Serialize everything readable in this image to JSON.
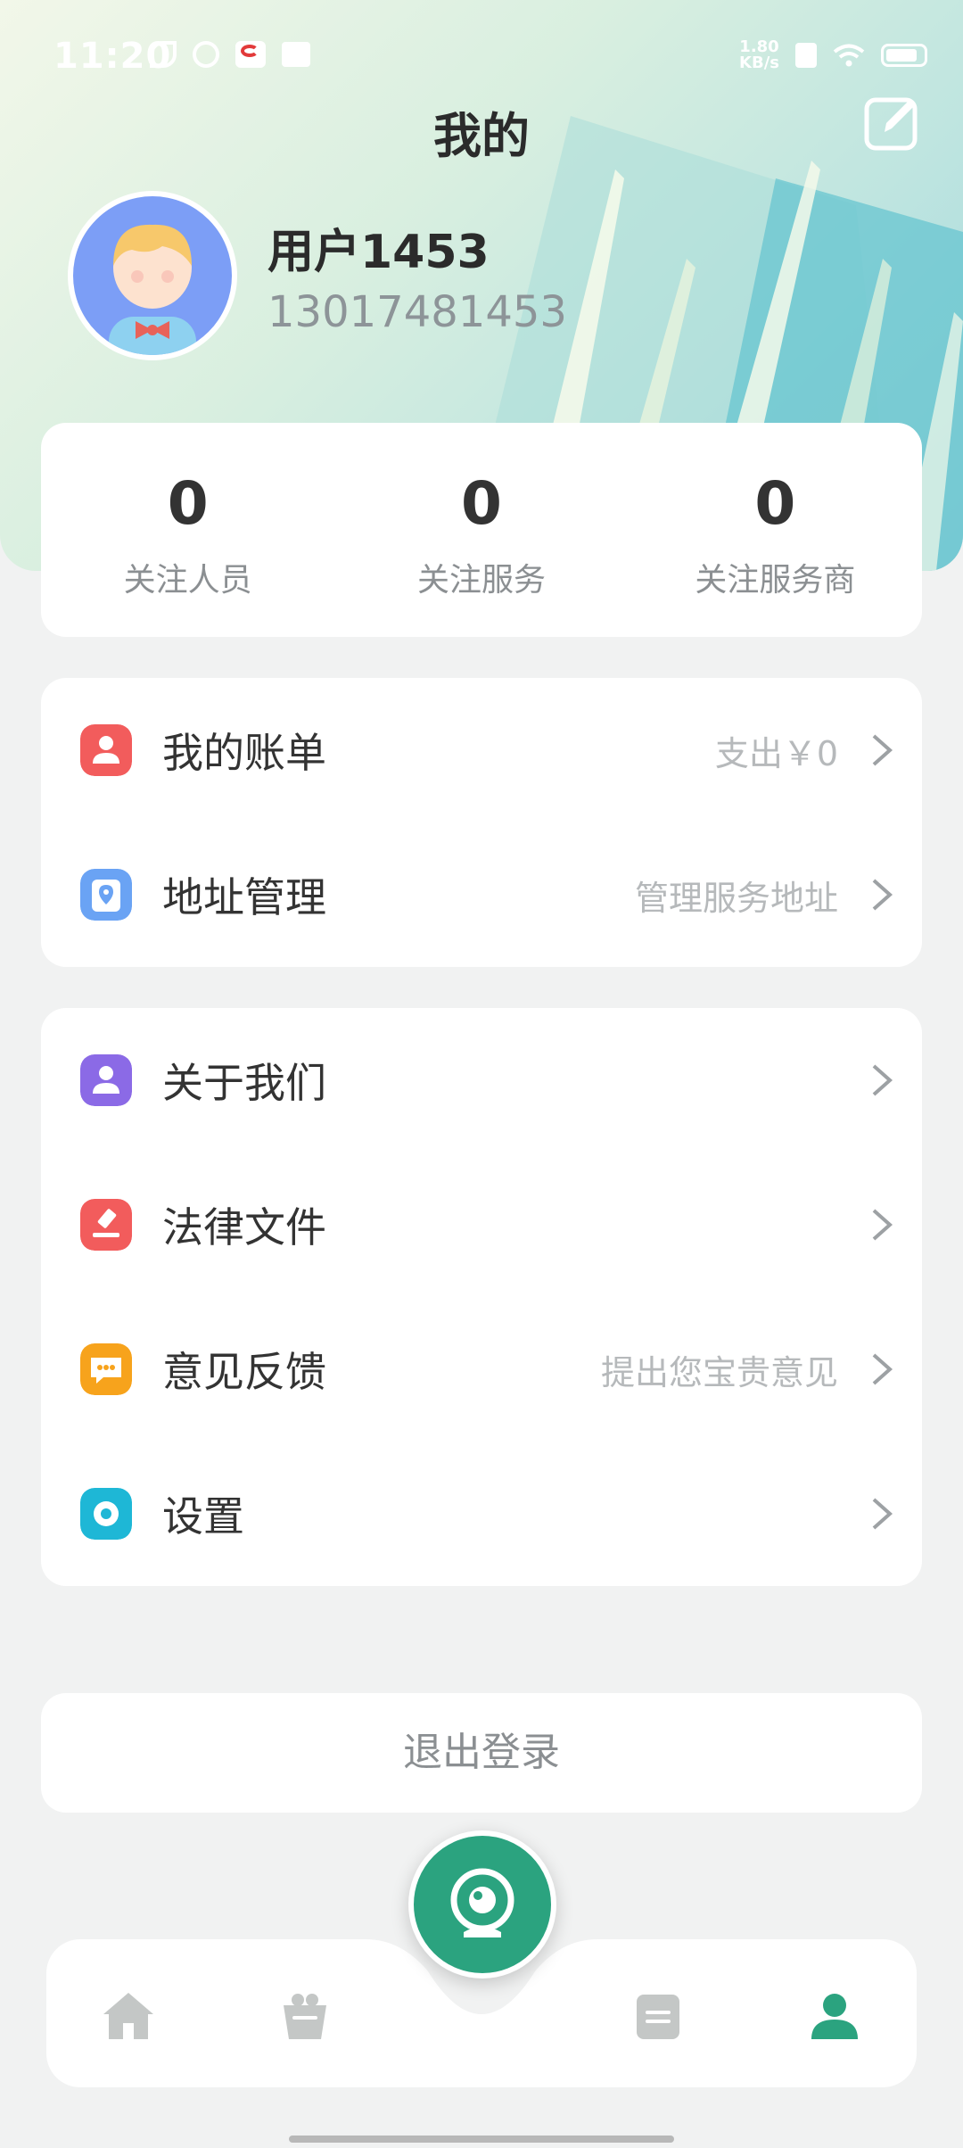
{
  "status_bar": {
    "time": "11:20",
    "net_speed": "1.80\nKB/s"
  },
  "header": {
    "title": "我的"
  },
  "profile": {
    "username": "用户1453",
    "phone": "13017481453"
  },
  "stats": [
    {
      "value": "0",
      "label": "关注人员"
    },
    {
      "value": "0",
      "label": "关注服务"
    },
    {
      "value": "0",
      "label": "关注服务商"
    }
  ],
  "menu_group_1": [
    {
      "label": "我的账单",
      "value": "支出￥0",
      "icon": "bill-icon",
      "color": "#f25c5c"
    },
    {
      "label": "地址管理",
      "value": "管理服务地址",
      "icon": "location-icon",
      "color": "#6aa3f4"
    }
  ],
  "menu_group_2": [
    {
      "label": "关于我们",
      "value": "",
      "icon": "about-icon",
      "color": "#8b6ae6"
    },
    {
      "label": "法律文件",
      "value": "",
      "icon": "gavel-icon",
      "color": "#f25c5c"
    },
    {
      "label": "意见反馈",
      "value": "提出您宝贵意见",
      "icon": "feedback-icon",
      "color": "#f7a31c"
    },
    {
      "label": "设置",
      "value": "",
      "icon": "settings-icon",
      "color": "#1eb7d6"
    }
  ],
  "logout": {
    "label": "退出登录"
  },
  "bottom_nav": {
    "items": [
      "home-icon",
      "gift-icon",
      "camera-icon",
      "orders-icon",
      "profile-icon"
    ],
    "active": "profile-icon",
    "accent": "#2ba37f"
  }
}
